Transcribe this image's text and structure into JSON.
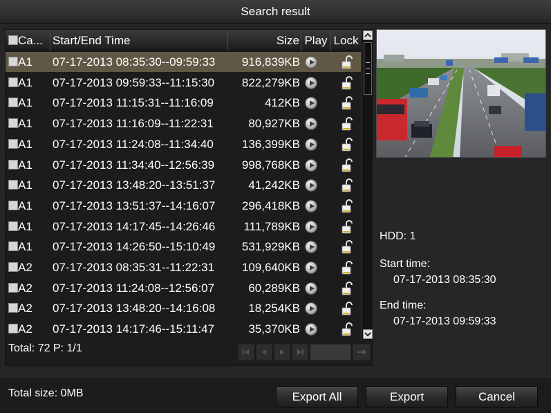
{
  "window": {
    "title": "Search result"
  },
  "table": {
    "headers": {
      "camera": "Ca...",
      "time": "Start/End Time",
      "size": "Size",
      "play": "Play",
      "lock": "Lock"
    },
    "rows": [
      {
        "camera": "A1",
        "time": "07-17-2013 08:35:30--09:59:33",
        "size": "916,839KB",
        "selected": true
      },
      {
        "camera": "A1",
        "time": "07-17-2013 09:59:33--11:15:30",
        "size": "822,279KB",
        "selected": false
      },
      {
        "camera": "A1",
        "time": "07-17-2013 11:15:31--11:16:09",
        "size": "412KB",
        "selected": false
      },
      {
        "camera": "A1",
        "time": "07-17-2013 11:16:09--11:22:31",
        "size": "80,927KB",
        "selected": false
      },
      {
        "camera": "A1",
        "time": "07-17-2013 11:24:08--11:34:40",
        "size": "136,399KB",
        "selected": false
      },
      {
        "camera": "A1",
        "time": "07-17-2013 11:34:40--12:56:39",
        "size": "998,768KB",
        "selected": false
      },
      {
        "camera": "A1",
        "time": "07-17-2013 13:48:20--13:51:37",
        "size": "41,242KB",
        "selected": false
      },
      {
        "camera": "A1",
        "time": "07-17-2013 13:51:37--14:16:07",
        "size": "296,418KB",
        "selected": false
      },
      {
        "camera": "A1",
        "time": "07-17-2013 14:17:45--14:26:46",
        "size": "111,789KB",
        "selected": false
      },
      {
        "camera": "A1",
        "time": "07-17-2013 14:26:50--15:10:49",
        "size": "531,929KB",
        "selected": false
      },
      {
        "camera": "A2",
        "time": "07-17-2013 08:35:31--11:22:31",
        "size": "109,640KB",
        "selected": false
      },
      {
        "camera": "A2",
        "time": "07-17-2013 11:24:08--12:56:07",
        "size": "60,289KB",
        "selected": false
      },
      {
        "camera": "A2",
        "time": "07-17-2013 13:48:20--14:16:08",
        "size": "18,254KB",
        "selected": false
      },
      {
        "camera": "A2",
        "time": "07-17-2013 14:17:46--15:11:47",
        "size": "35,370KB",
        "selected": false
      }
    ],
    "footer": "Total: 72  P: 1/1"
  },
  "details": {
    "hdd": "HDD: 1",
    "start_label": "Start time:",
    "start_value": "07-17-2013 08:35:30",
    "end_label": "End time:",
    "end_value": "07-17-2013 09:59:33"
  },
  "bottom": {
    "total_size": "Total size: 0MB",
    "export_all": "Export All",
    "export": "Export",
    "cancel": "Cancel"
  },
  "icons": {
    "play": "play-circle-icon",
    "lock": "unlocked-padlock-icon",
    "pager": [
      "first-page-icon",
      "prev-page-icon",
      "next-page-icon",
      "last-page-icon",
      "go-arrow-icon"
    ]
  },
  "colors": {
    "background": "#262626",
    "panel": "#1c1c1c",
    "selected_row": "#605845",
    "text": "#ffffff"
  }
}
